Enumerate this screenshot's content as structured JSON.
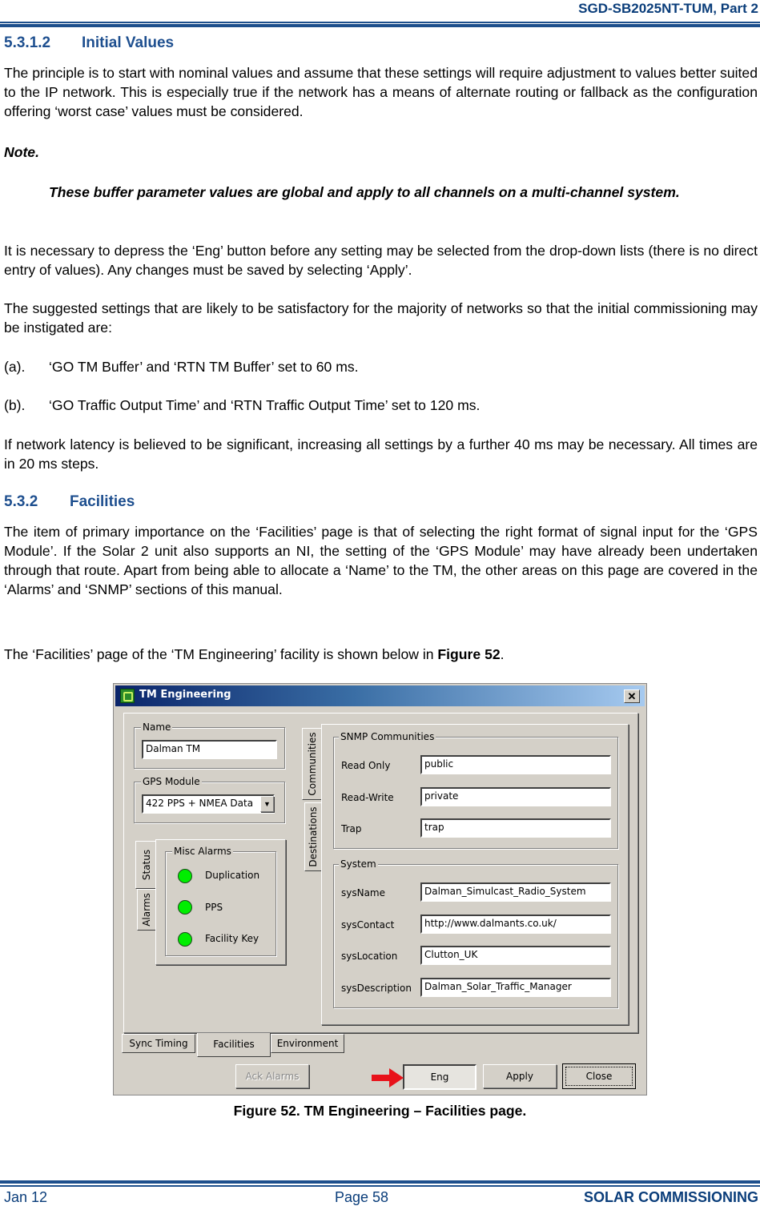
{
  "header": {
    "doc_id": "SGD-SB2025NT-TUM, Part 2"
  },
  "sections": {
    "initial_values": {
      "number": "5.3.1.2",
      "title": "Initial Values",
      "para1": "The principle is to start with nominal values and assume that these settings will require adjustment to values better suited to the IP network.  This is especially true if the network has a means of alternate routing or fallback as the configuration offering ‘worst case’ values must be considered.",
      "note_title": "Note.",
      "note_body": "These buffer parameter values are global and apply to all channels on a multi-channel system.",
      "para2": "It is necessary to depress the ‘Eng’ button before any setting may be selected from the drop-down lists (there is no direct entry of values).  Any changes must be saved by selecting ‘Apply’.",
      "para3": "The suggested settings that are likely to be satisfactory for the majority of networks so that the initial commissioning may be instigated are:",
      "list": [
        {
          "marker": "(a).",
          "text": "‘GO TM Buffer’ and ‘RTN TM Buffer’ set to 60 ms."
        },
        {
          "marker": "(b).",
          "text": "‘GO Traffic Output Time’ and ‘RTN Traffic Output Time’ set to 120 ms."
        }
      ],
      "para4": "If network latency is believed to be significant, increasing all settings by a further 40 ms may be necessary.  All times are in 20 ms steps."
    },
    "facilities": {
      "number": "5.3.2",
      "title": "Facilities",
      "para1": "The item of primary importance on the ‘Facilities’ page is that of selecting the right format of signal input for the ‘GPS Module’.  If the Solar 2 unit also supports an NI, the setting of the ‘GPS Module’ may have already been undertaken through that route.  Apart from being able to allocate a ‘Name’ to the TM, the other areas on this page are covered in the ‘Alarms’ and ‘SNMP’ sections of this manual.",
      "para2_prefix": "The ‘Facilities’ page of the ‘TM Engineering’ facility is shown below in ",
      "para2_ref": "Figure 52",
      "para2_suffix": "."
    }
  },
  "dialog": {
    "title": "TM Engineering",
    "close_glyph": "✕",
    "name_group": {
      "label": "Name",
      "value": "Dalman TM"
    },
    "gps_group": {
      "label": "GPS Module",
      "selected": "422 PPS + NMEA Data",
      "arrow": "▼"
    },
    "left_tabs": [
      "Status",
      "Alarms"
    ],
    "misc_alarms": {
      "label": "Misc Alarms",
      "items": [
        {
          "label": "Duplication",
          "status": "ok",
          "color": "#00ee00"
        },
        {
          "label": "PPS",
          "status": "ok",
          "color": "#00ee00"
        },
        {
          "label": "Facility Key",
          "status": "ok",
          "color": "#00ee00"
        }
      ]
    },
    "right_tabs": [
      "Communities",
      "Destinations"
    ],
    "snmp_communities": {
      "label": "SNMP Communities",
      "fields": [
        {
          "label": "Read Only",
          "value": "public"
        },
        {
          "label": "Read-Write",
          "value": "private"
        },
        {
          "label": "Trap",
          "value": "trap"
        }
      ]
    },
    "system": {
      "label": "System",
      "fields": [
        {
          "label": "sysName",
          "value": "Dalman_Simulcast_Radio_System"
        },
        {
          "label": "sysContact",
          "value": "http://www.dalmants.co.uk/"
        },
        {
          "label": "sysLocation",
          "value": "Clutton_UK"
        },
        {
          "label": "sysDescription",
          "value": "Dalman_Solar_Traffic_Manager"
        }
      ]
    },
    "bottom_tabs": [
      {
        "label": "Sync Timing",
        "active": false
      },
      {
        "label": "Facilities",
        "active": true
      },
      {
        "label": "Environment",
        "active": false
      }
    ],
    "buttons": {
      "ack_alarms": "Ack Alarms",
      "eng": "Eng",
      "apply": "Apply",
      "close": "Close"
    },
    "annotation_color": "#e8121a"
  },
  "figure_caption": "Figure 52.  TM Engineering – Facilities page.",
  "footer": {
    "date": "Jan 12",
    "page": "Page 58",
    "section": "SOLAR COMMISSIONING"
  }
}
